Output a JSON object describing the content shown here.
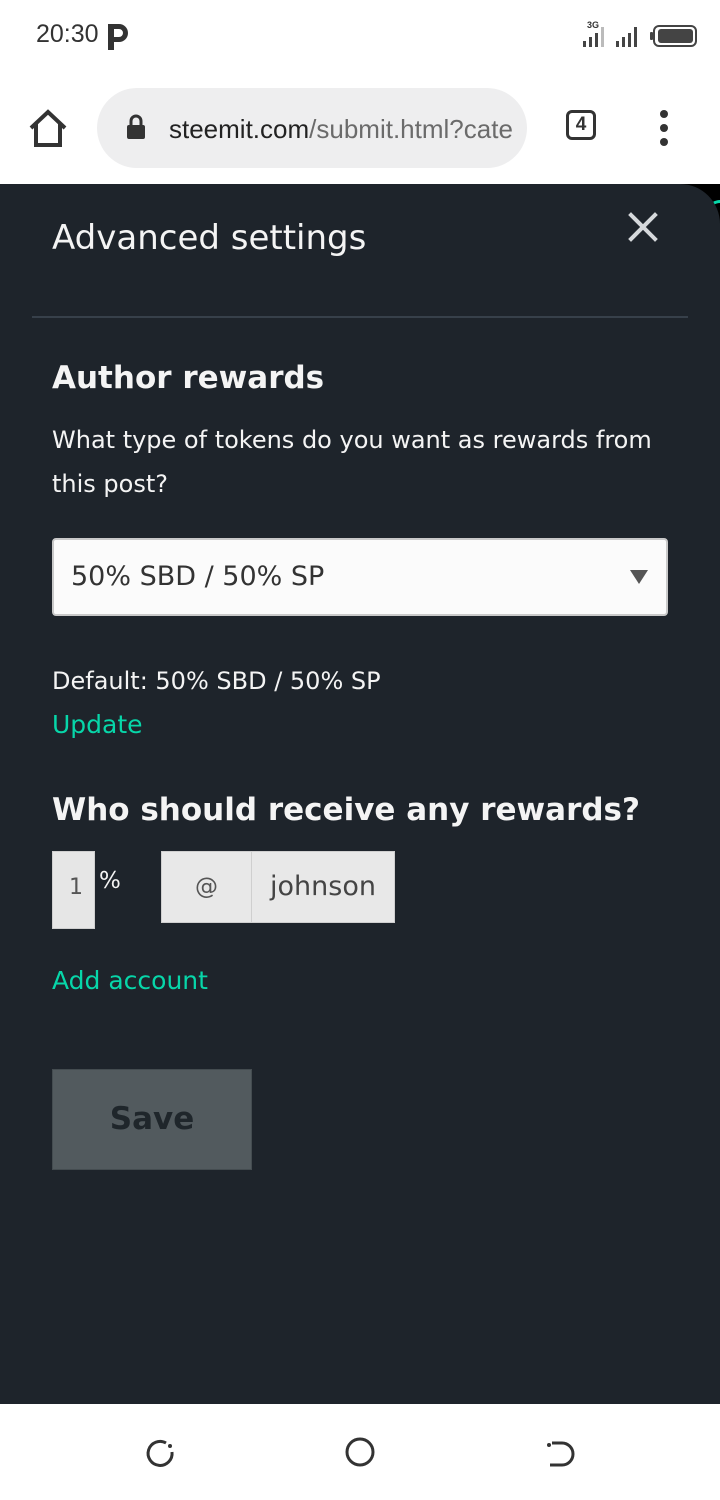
{
  "status_bar": {
    "time": "20:30",
    "network_label": "3G",
    "icons": [
      "p-app-icon",
      "signal-icon",
      "signal-icon",
      "battery-icon"
    ]
  },
  "browser": {
    "url_domain": "steemit.com",
    "url_path": "/submit.html?category=",
    "tab_count": "4",
    "icons": [
      "home-icon",
      "lock-icon",
      "kebab-menu-icon"
    ]
  },
  "modal": {
    "title": "Advanced settings",
    "close_icon": "close-icon",
    "author_rewards": {
      "heading": "Author rewards",
      "question": "What type of tokens do you want as rewards from this post?",
      "selected_option": "50% SBD / 50% SP",
      "default_text": "Default: 50% SBD / 50% SP",
      "update_link": "Update"
    },
    "beneficiaries": {
      "heading": "Who should receive any rewards?",
      "percent_value": "1",
      "percent_sign": "%",
      "at_symbol": "@",
      "account_value": "johnson",
      "add_account_link": "Add account"
    },
    "save_label": "Save"
  },
  "colors": {
    "modal_background": "#1e242b",
    "accent_link": "#07d6a9",
    "save_button": "#525a5e"
  },
  "nav_bar": {
    "icons": [
      "recent-apps-icon",
      "home-circle-icon",
      "back-icon"
    ]
  }
}
